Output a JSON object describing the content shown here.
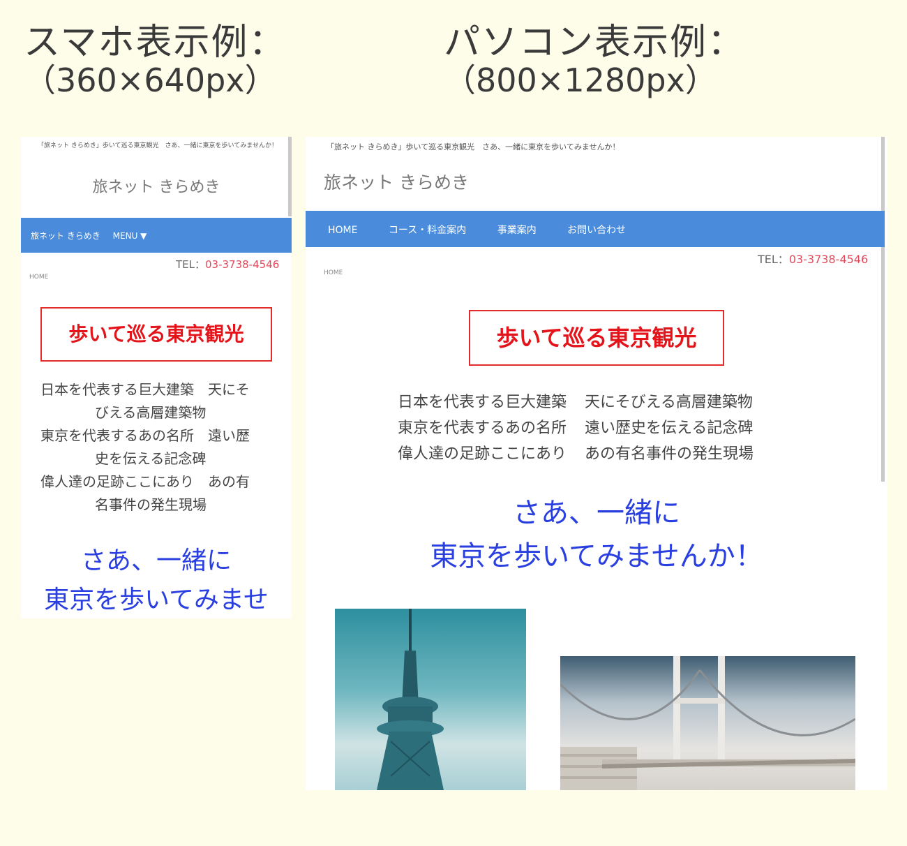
{
  "captions": {
    "smartphone": {
      "title": "スマホ表示例：",
      "size": "（360×640px）"
    },
    "pc": {
      "title": "パソコン表示例：",
      "size": "（800×1280px）"
    }
  },
  "site": {
    "tagline": "「旅ネット きらめき」歩いて巡る東京観光　さあ、一緒に東京を歩いてみませんか！",
    "name": "旅ネット きらめき",
    "tel_label": "TEL：",
    "tel_number": "03-3738-4546",
    "breadcrumb": "HOME",
    "headline": "歩いて巡る東京観光"
  },
  "sp_nav": {
    "brand": "旅ネット きらめき",
    "menu": "MENU ▼"
  },
  "pc_nav": {
    "items": [
      "HOME",
      "コース・料金案内",
      "事業案内",
      "お問い合わせ"
    ]
  },
  "poem": {
    "sp_lines": [
      "日本を代表する巨大建築　天にそ",
      "びえる高層建築物",
      "東京を代表するあの名所　遠い歴",
      "史を伝える記念碑",
      "偉人達の足跡ここにあり　あの有",
      "名事件の発生現場"
    ],
    "pc_rows": [
      [
        "日本を代表する巨大建築",
        "天にそびえる高層建築物"
      ],
      [
        "東京を代表するあの名所",
        "遠い歴史を伝える記念碑"
      ],
      [
        "偉人達の足跡ここにあり",
        "あの有名事件の発生現場"
      ]
    ]
  },
  "invite": {
    "line1": "さあ、一緒に",
    "line2_pc": "東京を歩いてみませんか！",
    "line2_sp": "東京を歩いてみませ"
  },
  "colors": {
    "nav": "#4a8cdb",
    "headline": "#e3151b",
    "invite": "#2a3fe0",
    "tel": "#e0495a",
    "background": "#fdfde9"
  }
}
